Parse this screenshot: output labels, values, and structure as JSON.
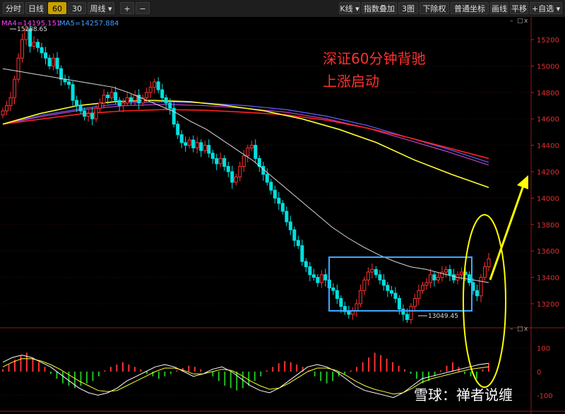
{
  "toolbar": {
    "left": [
      "分时",
      "日线",
      "60分",
      "30分",
      "周线 ▾"
    ],
    "active": "60分",
    "plus": "+",
    "minus": "−",
    "right": [
      "K线 ▾",
      "指数叠加 ▾",
      "3图 ▾",
      "下除权 ▾",
      "普通坐标 ▾",
      "画线",
      "平移",
      "+自选 ▾"
    ]
  },
  "ma_legend": [
    {
      "label": "MA4=14195.151",
      "color": "#ff40ff"
    },
    {
      "label": "MA5=14257.884",
      "color": "#40a0ff"
    }
  ],
  "annotation": {
    "line1": "深证60分钟背驰",
    "line2": "上涨启动"
  },
  "high_label": "15288.65",
  "low_label": "13049.45",
  "panel_controls": {
    "close": "x",
    "restore": "□",
    "minimize": "–"
  },
  "watermark": "雪球：禅者说缠",
  "colors": {
    "up": "#ff3232",
    "down": "#00e0e0",
    "ma_white": "#d8d8d8",
    "ma_yellow": "#ffff30",
    "ma_red": "#ff2020",
    "ma_purple": "#c040c0",
    "ma_blue": "#6060ff",
    "box": "#40a8ff",
    "ellipse": "#ffff00"
  },
  "chart_data": [
    {
      "type": "candlestick",
      "title": "",
      "ylim": [
        13050,
        15350
      ],
      "y_ticks": [
        13200,
        13400,
        13600,
        13800,
        14000,
        14200,
        14400,
        14600,
        14800,
        15000,
        15200
      ],
      "closes": [
        14660,
        14700,
        14760,
        14900,
        15060,
        15200,
        15280,
        15150,
        15180,
        15140,
        15100,
        15060,
        15000,
        15060,
        14980,
        14900,
        14880,
        14860,
        14740,
        14700,
        14660,
        14620,
        14640,
        14600,
        14680,
        14720,
        14780,
        14760,
        14800,
        14740,
        14700,
        14720,
        14760,
        14740,
        14780,
        14720,
        14760,
        14800,
        14840,
        14880,
        14820,
        14760,
        14720,
        14680,
        14560,
        14480,
        14420,
        14400,
        14440,
        14380,
        14420,
        14360,
        14400,
        14340,
        14300,
        14260,
        14300,
        14240,
        14200,
        14120,
        14160,
        14240,
        14320,
        14380,
        14400,
        14300,
        14240,
        14180,
        14120,
        14060,
        14000,
        13960,
        13900,
        13820,
        13760,
        13680,
        13640,
        13520,
        13480,
        13420,
        13400,
        13360,
        13420,
        13380,
        13320,
        13300,
        13240,
        13180,
        13140,
        13120,
        13150,
        13200,
        13300,
        13380,
        13440,
        13460,
        13420,
        13380,
        13340,
        13300,
        13280,
        13240,
        13160,
        13120,
        13080,
        13180,
        13240,
        13300,
        13340,
        13360,
        13420,
        13380,
        13400,
        13440,
        13460,
        13420,
        13380,
        13420,
        13440,
        13420,
        13360,
        13300,
        13260,
        13400,
        13480,
        13540
      ],
      "ma_white": [
        14980,
        14960,
        14940,
        14920,
        14900,
        14880,
        14860,
        14840,
        14800,
        14750,
        14700,
        14650,
        14580,
        14520,
        14440,
        14360,
        14280,
        14180,
        14080,
        13980,
        13880,
        13780,
        13700,
        13630,
        13570,
        13520,
        13480,
        13460,
        13430,
        13400,
        13380,
        13360
      ],
      "ma_yellow": [
        14560,
        14640,
        14700,
        14730,
        14740,
        14730,
        14700,
        14660,
        14600,
        14520,
        14420,
        14290,
        14180,
        14080
      ],
      "ma_red": [
        14560,
        14600,
        14640,
        14660,
        14670,
        14665,
        14650,
        14630,
        14590,
        14530,
        14460,
        14380,
        14300
      ],
      "ma_purple": [
        14560,
        14620,
        14670,
        14700,
        14710,
        14700,
        14680,
        14650,
        14600,
        14530,
        14440,
        14350,
        14250
      ],
      "ma_blue": [
        14560,
        14630,
        14680,
        14720,
        14730,
        14720,
        14700,
        14670,
        14620,
        14550,
        14460,
        14370,
        14270
      ]
    },
    {
      "type": "bar",
      "title": "MACD",
      "ylim": [
        -150,
        150
      ],
      "y_ticks": [
        100,
        0,
        -100
      ],
      "histogram": [
        10,
        30,
        50,
        70,
        80,
        60,
        40,
        20,
        -10,
        -30,
        -50,
        -60,
        -70,
        -60,
        -50,
        -40,
        -20,
        5,
        20,
        30,
        40,
        30,
        20,
        10,
        -10,
        -20,
        -30,
        -20,
        -10,
        5,
        15,
        25,
        20,
        10,
        -5,
        -20,
        -40,
        -60,
        -70,
        -80,
        -70,
        -60,
        -40,
        -20,
        5,
        20,
        35,
        45,
        40,
        30,
        20,
        5,
        -20,
        -40,
        -50,
        -40,
        -20,
        -10,
        5,
        20,
        40,
        60,
        80,
        70,
        55,
        40,
        25,
        10,
        -10,
        -30,
        -50,
        -40,
        -20,
        5,
        25,
        40,
        20,
        -10,
        -20,
        -30,
        10,
        35
      ],
      "dif": [
        40,
        60,
        70,
        60,
        40,
        20,
        -10,
        -40,
        -70,
        -90,
        -100,
        -90,
        -70,
        -40,
        -20,
        0,
        20,
        30,
        20,
        0,
        -20,
        -10,
        10,
        20,
        0,
        -30,
        -60,
        -80,
        -90,
        -70,
        -40,
        -10,
        20,
        30,
        20,
        0,
        -30,
        -60,
        -80,
        -90,
        -100,
        -110,
        -90,
        -60,
        -30,
        -20,
        -10,
        0,
        10,
        20,
        30,
        35
      ],
      "dea": [
        20,
        40,
        55,
        55,
        45,
        30,
        10,
        -15,
        -40,
        -60,
        -80,
        -85,
        -80,
        -60,
        -40,
        -20,
        0,
        15,
        15,
        5,
        -10,
        -10,
        0,
        10,
        5,
        -15,
        -40,
        -60,
        -75,
        -70,
        -50,
        -25,
        0,
        15,
        15,
        5,
        -15,
        -40,
        -60,
        -75,
        -85,
        -95,
        -90,
        -70,
        -45,
        -30,
        -20,
        -10,
        0,
        10,
        15,
        20
      ]
    }
  ]
}
